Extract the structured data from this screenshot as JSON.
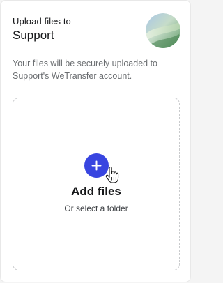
{
  "header": {
    "label": "Upload files to",
    "title": "Support"
  },
  "description": "Your files will be securely uploaded to Support's WeTransfer account.",
  "dropzone": {
    "add_title": "Add files",
    "folder_link": "Or select a folder"
  },
  "colors": {
    "accent": "#3845e0",
    "text_primary": "#17181a",
    "text_secondary": "#6a6d70",
    "dropzone_border": "#c9cbcd"
  },
  "icons": {
    "avatar": "support-avatar-icon",
    "add": "plus-icon",
    "cursor": "hand-pointer-cursor-icon"
  }
}
